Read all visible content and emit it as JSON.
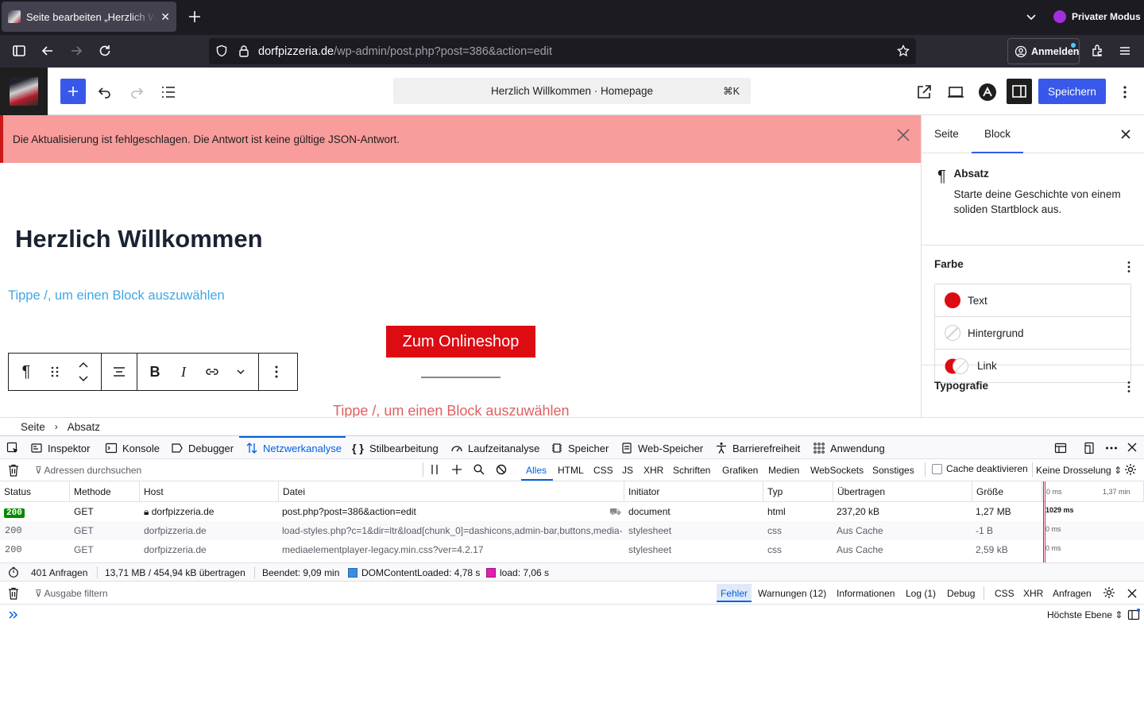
{
  "browser": {
    "tab_title": "Seite bearbeiten „Herzlich Willkommen“",
    "private_label": "Privater Modus",
    "url_host": "dorfpizzeria.de",
    "url_path": "/wp-admin/post.php?post=386&action=edit",
    "signin_label": "Anmelden"
  },
  "wp_toolbar": {
    "document_title": "Herzlich Willkommen · Homepage",
    "shortcut": "⌘K",
    "save_label": "Speichern"
  },
  "notice": {
    "text": "Die Aktualisierung ist fehlgeschlagen. Die Antwort ist keine gültige JSON-Antwort."
  },
  "canvas": {
    "heading": "Herzlich Willkommen",
    "placeholder_1": "Tippe /, um einen Block auszuwählen",
    "button_label": "Zum Onlineshop",
    "placeholder_2": "Tippe /, um einen Block auszuwählen"
  },
  "sidebar": {
    "tab_page": "Seite",
    "tab_block": "Block",
    "block_name": "Absatz",
    "block_desc": "Starte deine Geschichte von einem soliden Startblock aus.",
    "color_heading": "Farbe",
    "colors": [
      {
        "label": "Text",
        "color": "#dd0b12"
      },
      {
        "label": "Hintergrund",
        "color": "transparent"
      },
      {
        "label": "Link",
        "color": "#dd0b12"
      }
    ],
    "typography_heading": "Typografie"
  },
  "breadcrumb": {
    "root": "Seite",
    "current": "Absatz"
  },
  "devtools": {
    "tabs": [
      "Inspektor",
      "Konsole",
      "Debugger",
      "Netzwerkanalyse",
      "Stilbearbeitung",
      "Laufzeitanalyse",
      "Speicher",
      "Web-Speicher",
      "Barrierefreiheit",
      "Anwendung"
    ],
    "active_tab": "Netzwerkanalyse",
    "filter_placeholder": "Adressen durchsuchen",
    "type_filters": [
      "Alles",
      "HTML",
      "CSS",
      "JS",
      "XHR",
      "Schriften",
      "Grafiken",
      "Medien",
      "WebSockets",
      "Sonstiges"
    ],
    "cache_label": "Cache deaktivieren",
    "throttle_label": "Keine Drosselung",
    "columns": [
      "Status",
      "Methode",
      "Host",
      "Datei",
      "Initiator",
      "Typ",
      "Übertragen",
      "Größe"
    ],
    "waterfall_labels": [
      "0 ms",
      "1,37 min"
    ],
    "rows": [
      {
        "status": "200",
        "method": "GET",
        "host": "dorfpizzeria.de",
        "file": "post.php?post=386&action=edit",
        "initiator": "document",
        "type": "html",
        "transferred": "237,20 kB",
        "size": "1,27 MB",
        "timing": "1029 ms"
      },
      {
        "status": "200",
        "method": "GET",
        "host": "dorfpizzeria.de",
        "file": "load-styles.php?c=1&dir=ltr&load[chunk_0]=dashicons,admin-bar,buttons,media-",
        "initiator": "stylesheet",
        "type": "css",
        "transferred": "Aus Cache",
        "size": "-1 B",
        "timing": "0 ms"
      },
      {
        "status": "200",
        "method": "GET",
        "host": "dorfpizzeria.de",
        "file": "mediaelementplayer-legacy.min.css?ver=4.2.17",
        "initiator": "stylesheet",
        "type": "css",
        "transferred": "Aus Cache",
        "size": "2,59 kB",
        "timing": "0 ms"
      }
    ],
    "summary": {
      "requests": "401 Anfragen",
      "transferred": "13,71 MB / 454,94 kB übertragen",
      "finished": "Beendet: 9,09 min",
      "dcl": "DOMContentLoaded: 4,78 s",
      "load": "load: 7,06 s"
    },
    "console": {
      "filter_placeholder": "Ausgabe filtern",
      "levels": [
        "Fehler",
        "Warnungen (12)",
        "Informationen",
        "Log (1)",
        "Debug"
      ],
      "extra": [
        "CSS",
        "XHR",
        "Anfragen"
      ],
      "context": "Höchste Ebene"
    }
  }
}
